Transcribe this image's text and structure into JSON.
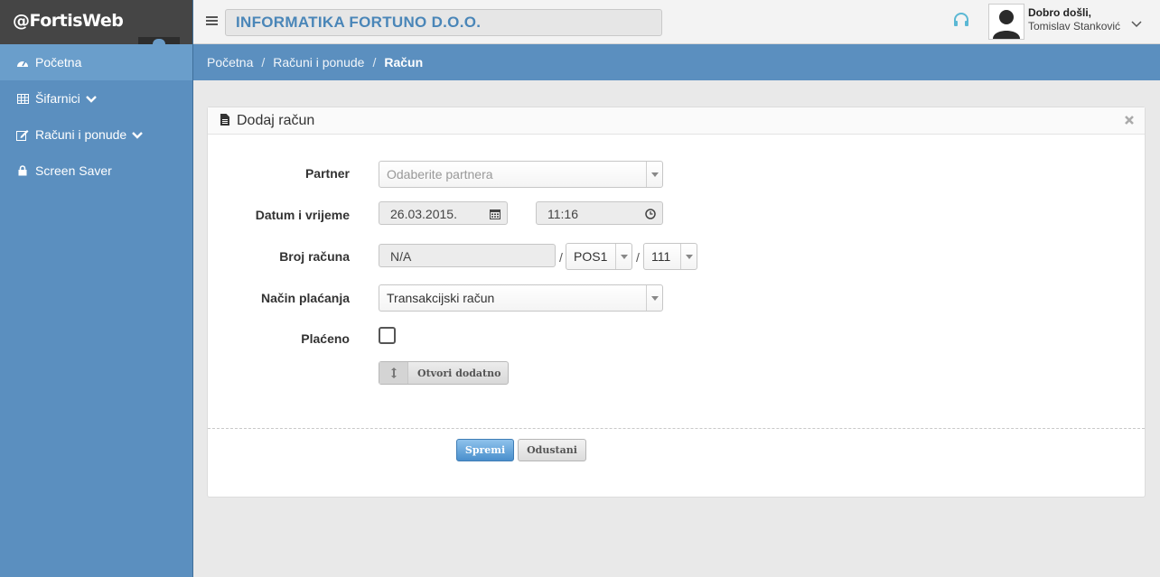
{
  "sidebar": {
    "logo": "@FortisWeb",
    "items": [
      {
        "label": "Početna",
        "icon": "dashboard-icon"
      },
      {
        "label": "Šifarnici",
        "icon": "table-icon"
      },
      {
        "label": "Računi i ponude",
        "icon": "edit-icon"
      },
      {
        "label": "Screen Saver",
        "icon": "lock-icon"
      }
    ]
  },
  "topbar": {
    "company": "INFORMATIKA FORTUNO D.O.O.",
    "greeting": "Dobro došli,",
    "user_name": "Tomislav Stanković"
  },
  "breadcrumb": {
    "items": [
      "Početna",
      "Računi i ponude"
    ],
    "current": "Račun"
  },
  "panel": {
    "title": "Dodaj račun"
  },
  "form": {
    "partner_label": "Partner",
    "partner_placeholder": "Odaberite partnera",
    "datetime_label": "Datum i vrijeme",
    "date_value": "26.03.2015.",
    "time_value": "11:16",
    "invoice_label": "Broj računa",
    "invoice_number": "N/A",
    "invoice_pos": "POS1",
    "invoice_device": "111",
    "payment_label": "Način plaćanja",
    "payment_value": "Transakcijski račun",
    "paid_label": "Plaćeno",
    "paid_checked": false,
    "more_button": "Otvori dodatno",
    "save_button": "Spremi",
    "cancel_button": "Odustani"
  },
  "colors": {
    "sidebar": "#5b8fbf",
    "accent": "#4a86b8",
    "logo_bar": "#454545",
    "save_button": "#4a8fcc"
  }
}
